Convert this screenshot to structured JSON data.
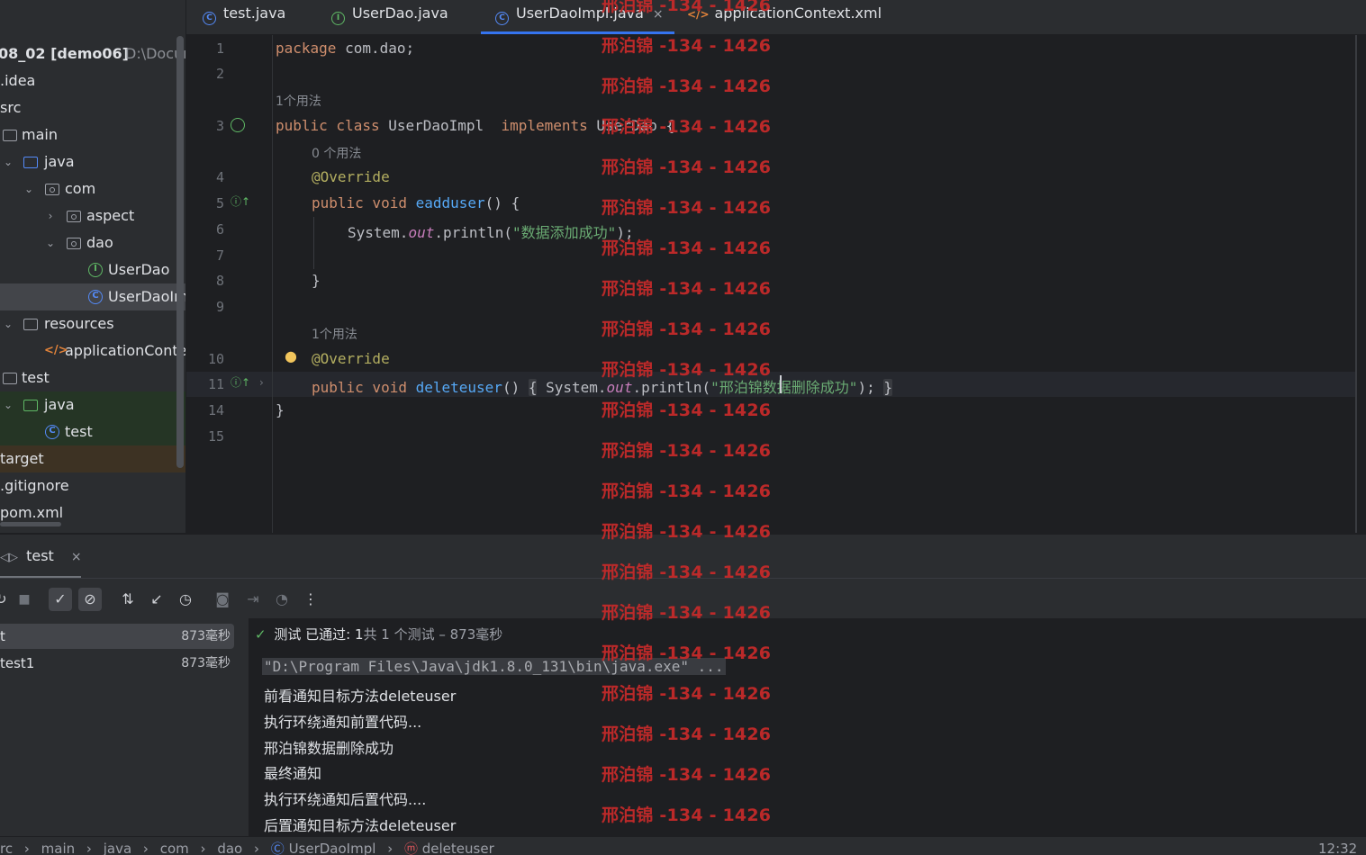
{
  "project": {
    "root_label": "08_02 [demo06]",
    "root_path": "D:\\Docur",
    "items": [
      {
        "label": ".idea"
      },
      {
        "label": "src"
      },
      {
        "label": "main"
      },
      {
        "label": "java"
      },
      {
        "label": "com"
      },
      {
        "label": "aspect"
      },
      {
        "label": "dao"
      },
      {
        "label": "UserDao"
      },
      {
        "label": "UserDaoImp"
      },
      {
        "label": "resources"
      },
      {
        "label": "applicationContex"
      },
      {
        "label": "test"
      },
      {
        "label": "java"
      },
      {
        "label": "test"
      },
      {
        "label": "target"
      },
      {
        "label": ".gitignore"
      },
      {
        "label": "pom.xml"
      }
    ]
  },
  "tabs": [
    {
      "label": "test.java",
      "icon": "class-icon"
    },
    {
      "label": "UserDao.java",
      "icon": "interface-icon"
    },
    {
      "label": "UserDaoImpl.java",
      "icon": "class-icon",
      "active": true,
      "close": "×"
    },
    {
      "label": "applicationContext.xml",
      "icon": "xml-icon"
    }
  ],
  "editor": {
    "line_numbers": [
      "1",
      "2",
      "3",
      "4",
      "5",
      "6",
      "7",
      "8",
      "9",
      "10",
      "11",
      "14",
      "15"
    ],
    "hints": {
      "h1": "1个用法",
      "h2": "0 个用法",
      "h3": "1个用法"
    },
    "code": {
      "l1_kw": "package",
      "l1_rest": " com.dao;",
      "l3_kw": "public class",
      "l3_name": " UserDaoImpl  ",
      "l3_kw2": "implements",
      "l3_rest": " UserDao {",
      "l4": "@Override",
      "l5_kw": "public void",
      "l5_fn": " eadduser",
      "l5_rest": "() {",
      "l6_a": "System.",
      "l6_out": "out",
      "l6_b": ".println(",
      "l6_str": "\"数据添加成功\"",
      "l6_c": ");",
      "l8": "}",
      "l10": "@Override",
      "l11_kw": "public void",
      "l11_fn": " deleteuser",
      "l11_paren": "()",
      "l11_open": "{",
      "l11_a": " System.",
      "l11_out": "out",
      "l11_b": ".println(",
      "l11_str": "\"邢泊锦数据删除成功\"",
      "l11_c": ");",
      "l11_close": "}",
      "l14": "}"
    }
  },
  "run": {
    "tab_label": "test",
    "tab_close": "×",
    "summary_status": "测试 已通过: 1",
    "summary_detail": "共 1 个测试 – 873毫秒",
    "tests": [
      {
        "name": "t",
        "time": "873毫秒"
      },
      {
        "name": "test1",
        "time": "873毫秒"
      }
    ],
    "console": [
      "\"D:\\Program Files\\Java\\jdk1.8.0_131\\bin\\java.exe\" ...",
      "前看通知目标方法deleteuser",
      "执行环绕通知前置代码...",
      "邢泊锦数据删除成功",
      "最终通知",
      "执行环绕通知后置代码....",
      "后置通知目标方法deleteuser"
    ]
  },
  "status": {
    "crumbs": [
      "rc",
      "main",
      "java",
      "com",
      "dao",
      "UserDaoImpl",
      "deleteuser"
    ],
    "time": "12:32"
  },
  "watermark": {
    "text": "邢泊锦 -134 - 1426",
    "color": "#c42a2a"
  }
}
